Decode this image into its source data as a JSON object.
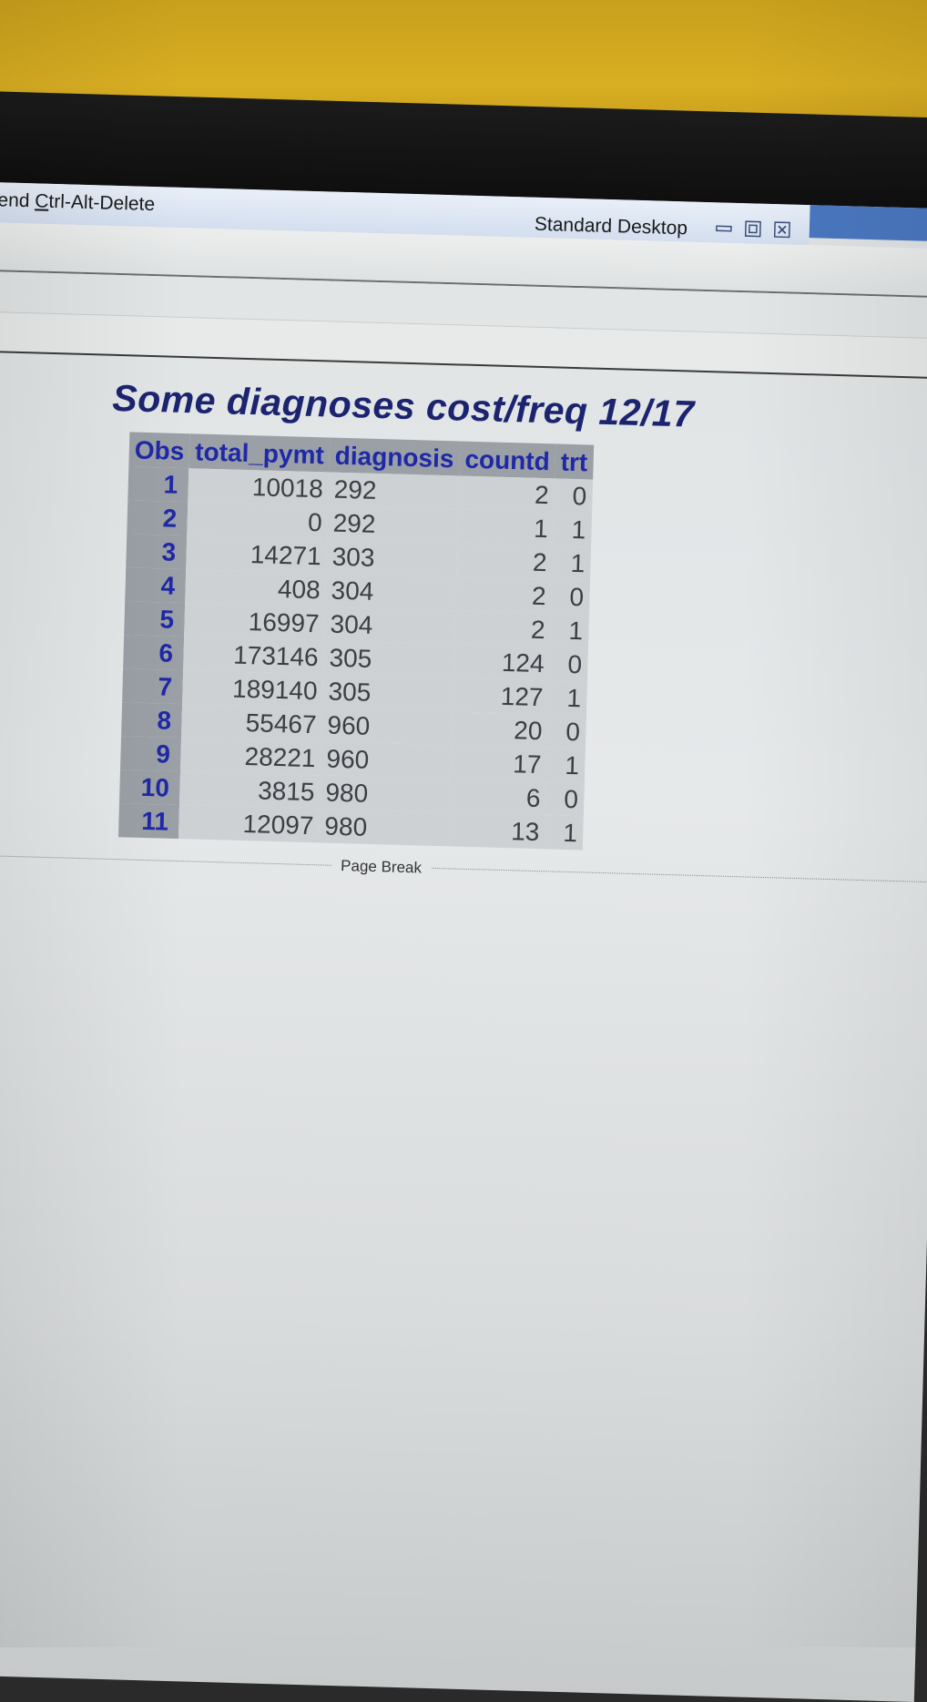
{
  "rdp": {
    "send_prefix": "end ",
    "send_accel": "C",
    "send_rest": "trl-Alt-Delete",
    "desktop_label": "Standard Desktop"
  },
  "report": {
    "title": "Some diagnoses cost/freq 12/17",
    "columns": [
      "Obs",
      "total_pymt",
      "diagnosis",
      "countd",
      "trt"
    ],
    "rows": [
      {
        "obs": "1",
        "total_pymt": "10018",
        "diagnosis": "292",
        "countd": "2",
        "trt": "0"
      },
      {
        "obs": "2",
        "total_pymt": "0",
        "diagnosis": "292",
        "countd": "1",
        "trt": "1"
      },
      {
        "obs": "3",
        "total_pymt": "14271",
        "diagnosis": "303",
        "countd": "2",
        "trt": "1"
      },
      {
        "obs": "4",
        "total_pymt": "408",
        "diagnosis": "304",
        "countd": "2",
        "trt": "0"
      },
      {
        "obs": "5",
        "total_pymt": "16997",
        "diagnosis": "304",
        "countd": "2",
        "trt": "1"
      },
      {
        "obs": "6",
        "total_pymt": "173146",
        "diagnosis": "305",
        "countd": "124",
        "trt": "0"
      },
      {
        "obs": "7",
        "total_pymt": "189140",
        "diagnosis": "305",
        "countd": "127",
        "trt": "1"
      },
      {
        "obs": "8",
        "total_pymt": "55467",
        "diagnosis": "960",
        "countd": "20",
        "trt": "0"
      },
      {
        "obs": "9",
        "total_pymt": "28221",
        "diagnosis": "960",
        "countd": "17",
        "trt": "1"
      },
      {
        "obs": "10",
        "total_pymt": "3815",
        "diagnosis": "980",
        "countd": "6",
        "trt": "0"
      },
      {
        "obs": "11",
        "total_pymt": "12097",
        "diagnosis": "980",
        "countd": "13",
        "trt": "1"
      }
    ],
    "page_break_label": "Page Break"
  },
  "icons": {
    "minimize": "minimize-icon",
    "restore": "restore-icon",
    "close": "close-icon"
  }
}
